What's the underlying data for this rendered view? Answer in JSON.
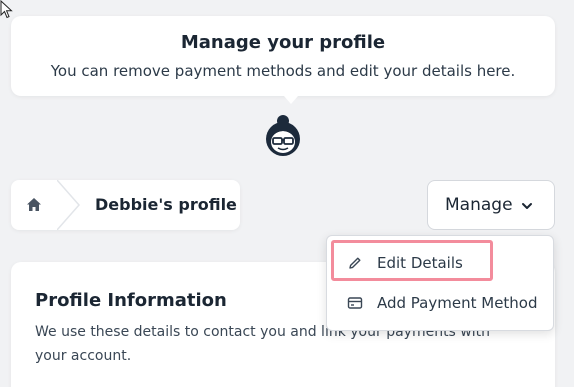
{
  "tooltip": {
    "title": "Manage your profile",
    "subtitle": "You can remove payment methods and edit your details here."
  },
  "breadcrumb": {
    "home_icon": "home-icon",
    "label": "Debbie's profile"
  },
  "manage": {
    "label": "Manage",
    "icon": "chevron-down-icon"
  },
  "menu": {
    "items": [
      {
        "label": "Edit Details",
        "icon": "pencil-icon",
        "highlighted": true
      },
      {
        "label": "Add Payment Method",
        "icon": "credit-card-icon",
        "highlighted": false
      }
    ]
  },
  "profile": {
    "title": "Profile Information",
    "description": "We use these details to contact you and link your payments with your account."
  },
  "colors": {
    "background": "#f1f2f4",
    "text_dark": "#1b2633",
    "highlight": "#f38c9c"
  }
}
